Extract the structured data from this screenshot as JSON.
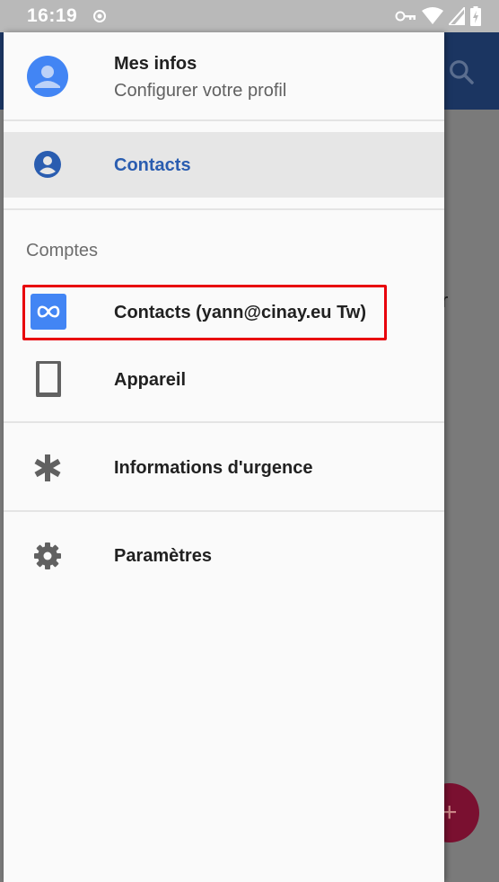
{
  "status_bar": {
    "time": "16:19",
    "icons": [
      "notification-dot-icon",
      "vpn-key-icon",
      "wifi-icon",
      "signal-icon",
      "battery-charging-icon"
    ]
  },
  "background_app": {
    "partial_text": "r",
    "fab_symbol": "+"
  },
  "drawer": {
    "profile": {
      "name": "Mes infos",
      "subtitle": "Configurer votre profil",
      "icon": "account-avatar-icon"
    },
    "primary_item": {
      "label": "Contacts",
      "icon": "account-circle-icon",
      "selected": true
    },
    "accounts_section": {
      "title": "Comptes",
      "items": [
        {
          "label": "Contacts (yann@cinay.eu Tw)",
          "icon": "infinity-sync-icon",
          "highlighted": true
        },
        {
          "label": "Appareil",
          "icon": "phone-device-icon"
        }
      ]
    },
    "menu_items": [
      {
        "label": "Informations d'urgence",
        "icon": "asterisk-icon"
      },
      {
        "label": "Paramètres",
        "icon": "gear-icon"
      }
    ]
  },
  "colors": {
    "accent": "#2a5db0",
    "highlight_border": "#e8000b",
    "avatar": "#4285f4",
    "toolbar": "#1b3561"
  }
}
